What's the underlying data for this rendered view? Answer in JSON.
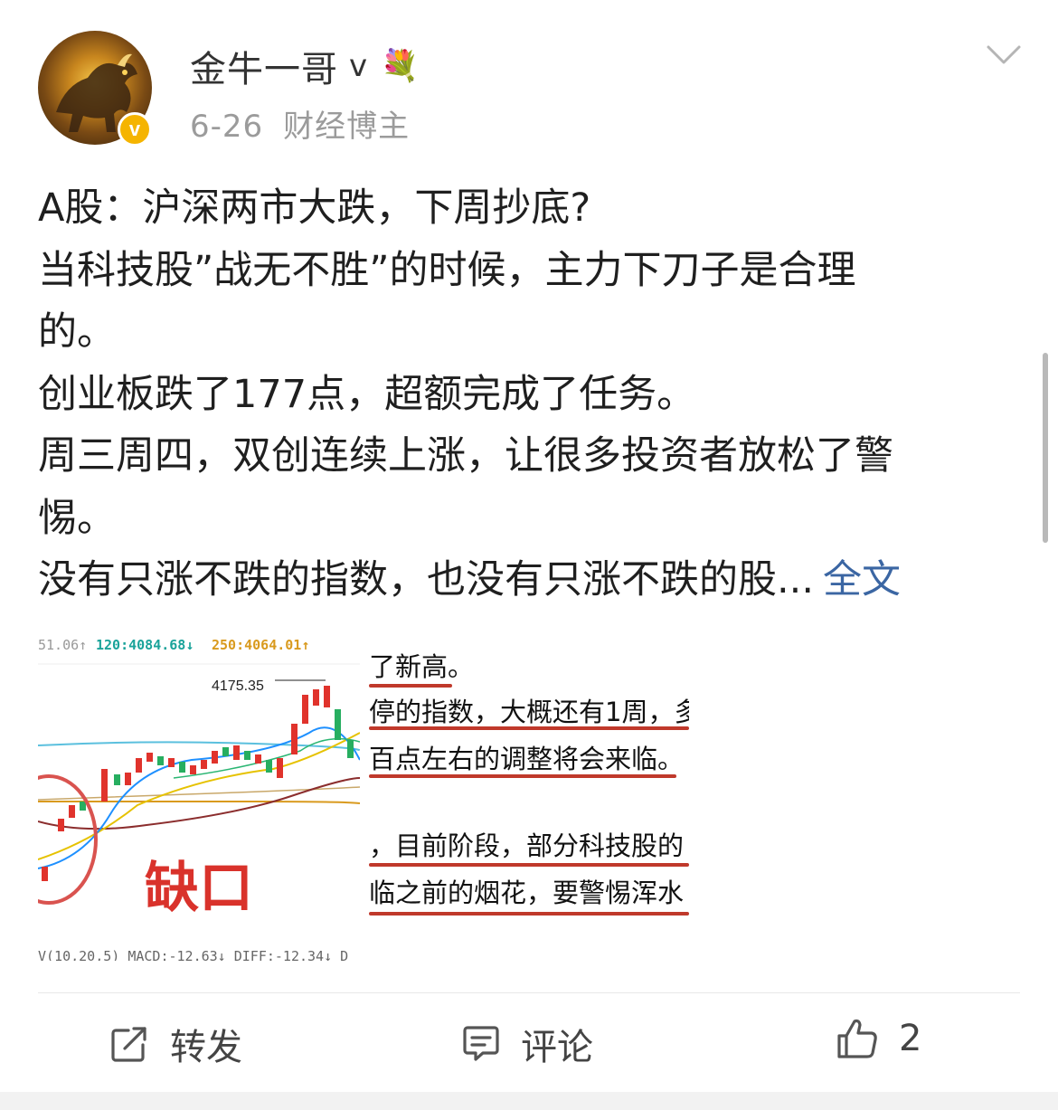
{
  "post": {
    "author": {
      "name": "金牛一哥",
      "verified_mark": "v",
      "badge_icon": "sunflower-bouquet",
      "badge_glyph": "💐"
    },
    "meta": {
      "date": "6-26",
      "category": "财经博主"
    },
    "text_lines": [
      "A股：沪深两市大跌，下周抄底?",
      "当科技股”战无不胜”的时候，主力下刀子是合理",
      "的。",
      "创业板跌了177点，超额完成了任务。",
      "周三周四，双创连续上涨，让很多投资者放松了警",
      "惕。",
      "没有只涨不跌的指数，也没有只涨不跌的股..."
    ],
    "more_link": "全文",
    "image": {
      "ma_legend": {
        "ma1": "51.06↑",
        "ma2": "120:4084.68↓",
        "ma3": "250:4064.01↑"
      },
      "peak_label": "4175.35",
      "gap_label": "缺口",
      "bottom_legend": "V(10,20,5)  MACD:-12.63↓  DIFF:-12.34↓  D",
      "notes": [
        "了新高。",
        "停的指数，大概还有1周，多",
        "百点左右的调整将会来临。",
        "，目前阶段，部分科技股的",
        "临之前的烟花，要警惕浑水"
      ]
    },
    "actions": {
      "repost": "转发",
      "comment": "评论",
      "like_count": "2"
    }
  },
  "colors": {
    "link": "#3b66a3",
    "accent_red": "#c0392b",
    "muted": "#9b9b9b"
  }
}
